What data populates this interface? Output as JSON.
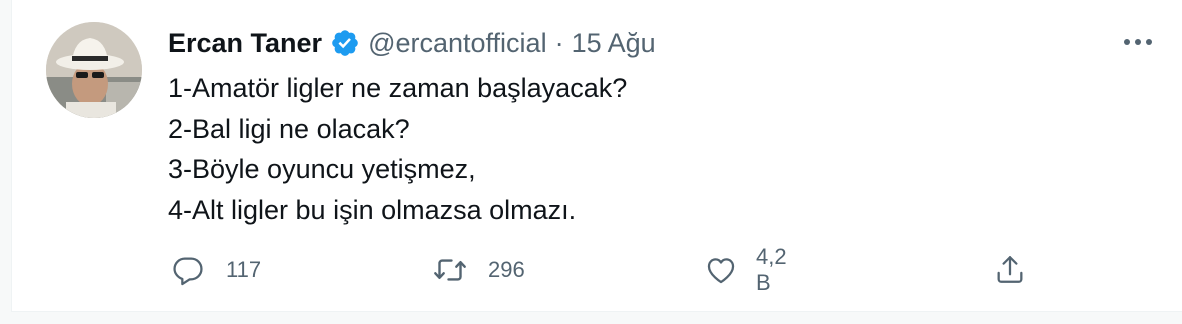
{
  "tweet": {
    "author_name": "Ercan Taner",
    "handle": "@ercantofficial",
    "separator": "·",
    "date": "15 Ağu",
    "lines": [
      "1-Amatör ligler ne zaman başlayacak?",
      "2-Bal ligi ne olacak?",
      "3-Böyle oyuncu yetişmez,",
      "4-Alt ligler bu işin olmazsa olmazı."
    ]
  },
  "actions": {
    "reply_count": "117",
    "retweet_count": "296",
    "like_count": "4,2 B"
  },
  "colors": {
    "verified_blue": "#1d9bf0",
    "text_primary": "#0f1419",
    "text_secondary": "#536471"
  }
}
